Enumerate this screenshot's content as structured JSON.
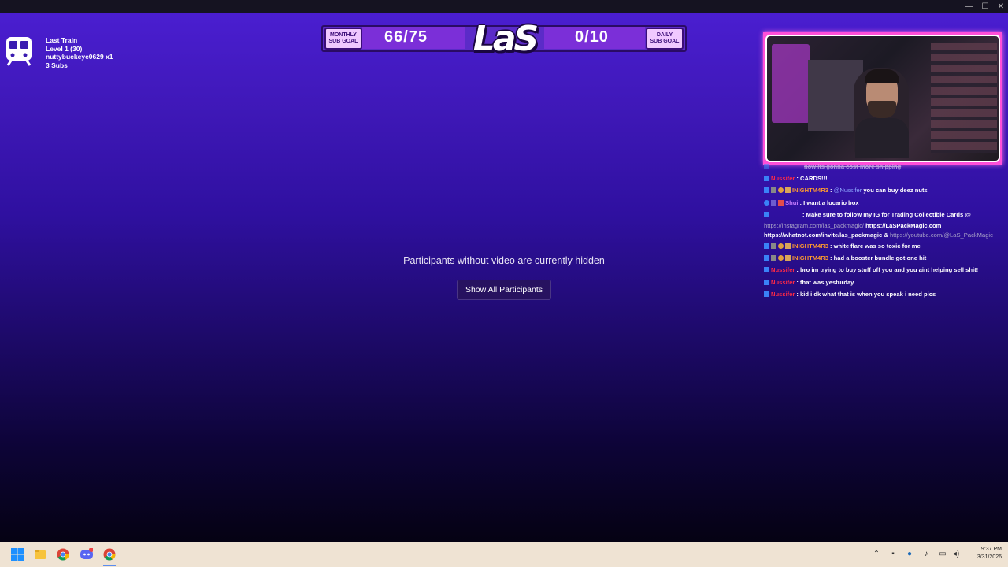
{
  "window": {
    "controls": [
      "—",
      "☐",
      "✕"
    ]
  },
  "train": {
    "icon": "train-icon",
    "lines": [
      "Last Train",
      "Level 1  (30)",
      "nuttybuckeye0629 x1",
      "3 Subs"
    ]
  },
  "goals": {
    "monthly_label_top": "MONTHLY",
    "monthly_label_bottom": "SUB GOAL",
    "monthly_value": "66/75",
    "logo": "LaS",
    "daily_value": "0/10",
    "daily_label_top": "DAILY",
    "daily_label_bottom": "SUB GOAL"
  },
  "chat": {
    "messages": [
      {
        "user": "",
        "text": "now its gonna cost more shipping",
        "user_color": "#ff3b5c",
        "faded": true
      },
      {
        "user": "Nussifer",
        "text": "CARDS!!!",
        "user_color": "#ff2a45"
      },
      {
        "user": "INIGHTM4R3",
        "text": "you can buy deez nuts",
        "mention": "@Nussifer",
        "user_color": "#ff9a2e"
      },
      {
        "user": "Shui",
        "text": "I want a lucario box",
        "user_color": "#c77dff"
      },
      {
        "user": "",
        "text": "Make sure to follow my IG for Trading Collectible Cards @",
        "user_color": "#8a7dff"
      }
    ],
    "promo_line2_link": "https://instagram.com/las_packmagic/",
    "promo_line2_text": "https://LaSPackMagic.com",
    "promo_line3_text": "https://whatnot.com/invite/las_packmagic &",
    "promo_line3_link": "https://youtube.com/@LaS_PackMagic",
    "messages_after": [
      {
        "user": "INIGHTM4R3",
        "text": "white flare was so toxic for me",
        "user_color": "#ff9a2e"
      },
      {
        "user": "INIGHTM4R3",
        "text": "had a booster bundle got one hit",
        "user_color": "#ff9a2e"
      },
      {
        "user": "Nussifer",
        "text": "bro im trying to buy stuff off you and you aint helping sell shit!",
        "user_color": "#ff2a45"
      },
      {
        "user": "Nussifer",
        "text": "that was yesturday",
        "user_color": "#ff2a45"
      },
      {
        "user": "Nussifer",
        "text": "kid i dk what that is when you speak i need pics",
        "user_color": "#ff2a45"
      }
    ]
  },
  "center": {
    "hidden_message": "Participants without video are currently hidden",
    "show_all_button": "Show All Participants"
  },
  "taskbar": {
    "apps": [
      "windows-start-icon",
      "file-explorer-icon",
      "chrome-icon",
      "discord-icon",
      "chrome-icon"
    ],
    "discord_badge": "24",
    "tray": [
      "chevron-up-icon",
      "wifi-icon",
      "steam-icon",
      "microphone-icon",
      "display-icon",
      "speaker-icon"
    ],
    "time": "9:37 PM",
    "date": "3/31/2026"
  },
  "colors": {
    "bg_top": "#4a1ed0",
    "bg_bottom": "#050213",
    "webcam_border": "#ff4fd8",
    "taskbar": "#efe3d3"
  }
}
